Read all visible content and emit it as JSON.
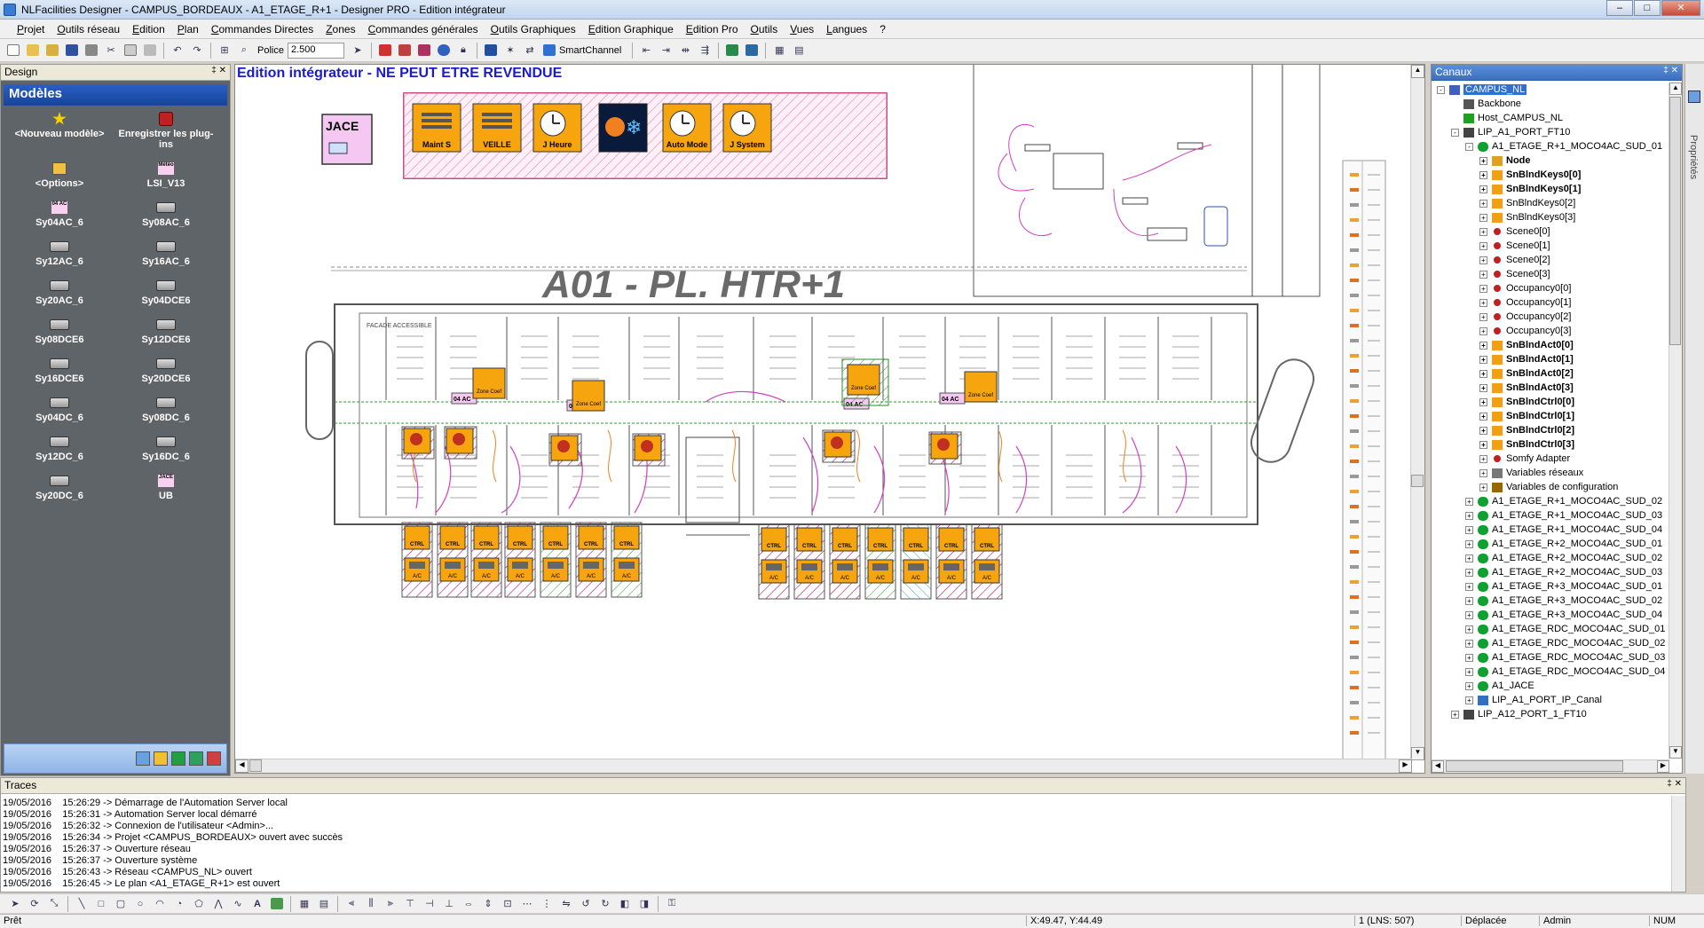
{
  "window": {
    "title": "NLFacilities Designer - CAMPUS_BORDEAUX - A1_ETAGE_R+1 - Designer PRO - Edition intégrateur",
    "min": "–",
    "max": "□",
    "close": "✕"
  },
  "menu": [
    "Projet",
    "Outils réseau",
    "Edition",
    "Plan",
    "Commandes Directes",
    "Zones",
    "Commandes générales",
    "Outils Graphiques",
    "Edition Graphique",
    "Edition Pro",
    "Outils",
    "Vues",
    "Langues",
    "?"
  ],
  "toolbar": {
    "police_label": "Police",
    "zoom": "2.500",
    "smartchannel_label": "SmartChannel"
  },
  "design_panel": {
    "header": "Design",
    "pin": "‡ ✕",
    "models_title": "Modèles",
    "models": [
      {
        "label": "<Nouveau modèle>",
        "icon": "star-wand-icon"
      },
      {
        "label": "Enregistrer les plug-ins",
        "icon": "plugin-dice-icon"
      },
      {
        "label": "<Options>",
        "icon": "options-icon"
      },
      {
        "label": "LSI_V13",
        "icon": "meteo-icon",
        "tag": "Météo"
      },
      {
        "label": "Sy04AC_6",
        "icon": "module-icon",
        "tag": "04 AC"
      },
      {
        "label": "Sy08AC_6",
        "icon": "network-icon"
      },
      {
        "label": "Sy12AC_6",
        "icon": "network-icon"
      },
      {
        "label": "Sy16AC_6",
        "icon": "network-icon"
      },
      {
        "label": "Sy20AC_6",
        "icon": "network-icon"
      },
      {
        "label": "Sy04DCE6",
        "icon": "network-icon"
      },
      {
        "label": "Sy08DCE6",
        "icon": "network-icon"
      },
      {
        "label": "Sy12DCE6",
        "icon": "network-icon"
      },
      {
        "label": "Sy16DCE6",
        "icon": "network-icon"
      },
      {
        "label": "Sy20DCE6",
        "icon": "network-icon"
      },
      {
        "label": "Sy04DC_6",
        "icon": "network-icon"
      },
      {
        "label": "Sy08DC_6",
        "icon": "network-icon"
      },
      {
        "label": "Sy12DC_6",
        "icon": "network-icon"
      },
      {
        "label": "Sy16DC_6",
        "icon": "network-icon"
      },
      {
        "label": "Sy20DC_6",
        "icon": "network-icon"
      },
      {
        "label": "UB",
        "icon": "jace-icon",
        "tag": "JACE"
      }
    ]
  },
  "canvas": {
    "title": "Edition intégrateur - NE PEUT ETRE REVENDUE",
    "plan_title": "A01 - PL. HTR+1",
    "jace_label": "JACE",
    "command_buttons": [
      "Maint S",
      "VEILLE",
      "J Heure",
      "",
      "Auto Mode",
      "J System"
    ],
    "command_icons": [
      "maintenance-icon",
      "veille-icon",
      "clock-icon",
      "weather-icon",
      "auto-mode-icon",
      "system-icon"
    ],
    "zone_labels": [
      "04 AC",
      "04 AC",
      "04 AC",
      "04 AC"
    ],
    "zone_coef_labels": [
      "Zone Coef",
      "Zone Coef",
      "Zone Coef",
      "Zone Coef"
    ],
    "ctrl_label": "CTRL",
    "ac_label": "A/C",
    "facade_label": "FACADE ACCESSIBLE",
    "colors": {
      "orange": "#f7a50e",
      "pink": "#d040c0",
      "green": "#2c9a2c",
      "hatch": "#b01060"
    }
  },
  "canaux_panel": {
    "header": "Canaux",
    "pin": "‡ ✕",
    "tree": [
      {
        "label": "CAMPUS_NL",
        "level": 0,
        "exp": "-",
        "icon": "project-icon",
        "selected": true
      },
      {
        "label": "Backbone",
        "level": 1,
        "exp": "",
        "icon": "backbone-icon"
      },
      {
        "label": "Host_CAMPUS_NL",
        "level": 1,
        "exp": "",
        "icon": "host-icon"
      },
      {
        "label": "LIP_A1_PORT_FT10",
        "level": 1,
        "exp": "-",
        "icon": "port-icon"
      },
      {
        "label": "A1_ETAGE_R+1_MOCO4AC_SUD_01",
        "level": 2,
        "exp": "-",
        "icon": "device-icon"
      },
      {
        "label": "Node",
        "level": 3,
        "exp": "+",
        "icon": "node-icon",
        "bold": true
      },
      {
        "label": "SnBlndKeys0[0]",
        "level": 3,
        "exp": "+",
        "icon": "block-icon",
        "bold": true
      },
      {
        "label": "SnBlndKeys0[1]",
        "level": 3,
        "exp": "+",
        "icon": "block-icon",
        "bold": true
      },
      {
        "label": "SnBlndKeys0[2]",
        "level": 3,
        "exp": "+",
        "icon": "block-icon"
      },
      {
        "label": "SnBlndKeys0[3]",
        "level": 3,
        "exp": "+",
        "icon": "block-icon"
      },
      {
        "label": "Scene0[0]",
        "level": 3,
        "exp": "+",
        "icon": "dot-icon"
      },
      {
        "label": "Scene0[1]",
        "level": 3,
        "exp": "+",
        "icon": "dot-icon"
      },
      {
        "label": "Scene0[2]",
        "level": 3,
        "exp": "+",
        "icon": "dot-icon"
      },
      {
        "label": "Scene0[3]",
        "level": 3,
        "exp": "+",
        "icon": "dot-icon"
      },
      {
        "label": "Occupancy0[0]",
        "level": 3,
        "exp": "+",
        "icon": "dot-icon"
      },
      {
        "label": "Occupancy0[1]",
        "level": 3,
        "exp": "+",
        "icon": "dot-icon"
      },
      {
        "label": "Occupancy0[2]",
        "level": 3,
        "exp": "+",
        "icon": "dot-icon"
      },
      {
        "label": "Occupancy0[3]",
        "level": 3,
        "exp": "+",
        "icon": "dot-icon"
      },
      {
        "label": "SnBlndAct0[0]",
        "level": 3,
        "exp": "+",
        "icon": "block-icon",
        "bold": true
      },
      {
        "label": "SnBlndAct0[1]",
        "level": 3,
        "exp": "+",
        "icon": "block-icon",
        "bold": true
      },
      {
        "label": "SnBlndAct0[2]",
        "level": 3,
        "exp": "+",
        "icon": "block-icon",
        "bold": true
      },
      {
        "label": "SnBlndAct0[3]",
        "level": 3,
        "exp": "+",
        "icon": "block-icon",
        "bold": true
      },
      {
        "label": "SnBlndCtrl0[0]",
        "level": 3,
        "exp": "+",
        "icon": "block-icon",
        "bold": true
      },
      {
        "label": "SnBlndCtrl0[1]",
        "level": 3,
        "exp": "+",
        "icon": "block-icon",
        "bold": true
      },
      {
        "label": "SnBlndCtrl0[2]",
        "level": 3,
        "exp": "+",
        "icon": "block-icon",
        "bold": true
      },
      {
        "label": "SnBlndCtrl0[3]",
        "level": 3,
        "exp": "+",
        "icon": "block-icon",
        "bold": true
      },
      {
        "label": "Somfy Adapter",
        "level": 3,
        "exp": "+",
        "icon": "dot-icon"
      },
      {
        "label": "Variables réseaux",
        "level": 3,
        "exp": "+",
        "icon": "variables-icon"
      },
      {
        "label": "Variables de configuration",
        "level": 3,
        "exp": "+",
        "icon": "config-icon"
      },
      {
        "label": "A1_ETAGE_R+1_MOCO4AC_SUD_02",
        "level": 2,
        "exp": "+",
        "icon": "device-icon"
      },
      {
        "label": "A1_ETAGE_R+1_MOCO4AC_SUD_03",
        "level": 2,
        "exp": "+",
        "icon": "device-icon"
      },
      {
        "label": "A1_ETAGE_R+1_MOCO4AC_SUD_04",
        "level": 2,
        "exp": "+",
        "icon": "device-icon"
      },
      {
        "label": "A1_ETAGE_R+2_MOCO4AC_SUD_01",
        "level": 2,
        "exp": "+",
        "icon": "device-icon"
      },
      {
        "label": "A1_ETAGE_R+2_MOCO4AC_SUD_02",
        "level": 2,
        "exp": "+",
        "icon": "device-icon"
      },
      {
        "label": "A1_ETAGE_R+2_MOCO4AC_SUD_03",
        "level": 2,
        "exp": "+",
        "icon": "device-icon"
      },
      {
        "label": "A1_ETAGE_R+3_MOCO4AC_SUD_01",
        "level": 2,
        "exp": "+",
        "icon": "device-icon"
      },
      {
        "label": "A1_ETAGE_R+3_MOCO4AC_SUD_02",
        "level": 2,
        "exp": "+",
        "icon": "device-icon"
      },
      {
        "label": "A1_ETAGE_R+3_MOCO4AC_SUD_04",
        "level": 2,
        "exp": "+",
        "icon": "device-icon"
      },
      {
        "label": "A1_ETAGE_RDC_MOCO4AC_SUD_01",
        "level": 2,
        "exp": "+",
        "icon": "device-icon"
      },
      {
        "label": "A1_ETAGE_RDC_MOCO4AC_SUD_02",
        "level": 2,
        "exp": "+",
        "icon": "device-icon"
      },
      {
        "label": "A1_ETAGE_RDC_MOCO4AC_SUD_03",
        "level": 2,
        "exp": "+",
        "icon": "device-icon"
      },
      {
        "label": "A1_ETAGE_RDC_MOCO4AC_SUD_04",
        "level": 2,
        "exp": "+",
        "icon": "device-icon"
      },
      {
        "label": "A1_JACE",
        "level": 2,
        "exp": "+",
        "icon": "device-icon"
      },
      {
        "label": "LIP_A1_PORT_IP_Canal",
        "level": 2,
        "exp": "+",
        "icon": "ip-icon"
      },
      {
        "label": "LIP_A12_PORT_1_FT10",
        "level": 1,
        "exp": "+",
        "icon": "port-icon"
      }
    ]
  },
  "props_strip": {
    "label": "Propriétés"
  },
  "traces": {
    "header": "Traces",
    "pin": "‡ ✕",
    "lines": [
      "19/05/2016    15:26:29 -> Démarrage de l'Automation Server local",
      "19/05/2016    15:26:31 -> Automation Server local démarré",
      "19/05/2016    15:26:32 -> Connexion de l'utilisateur <Admin>...",
      "19/05/2016    15:26:34 -> Projet <CAMPUS_BORDEAUX> ouvert avec succès",
      "19/05/2016    15:26:37 -> Ouverture réseau",
      "19/05/2016    15:26:37 -> Ouverture système",
      "19/05/2016    15:26:43 -> Réseau <CAMPUS_NL> ouvert",
      "19/05/2016    15:26:45 -> Le plan <A1_ETAGE_R+1> est ouvert"
    ]
  },
  "status": {
    "ready": "Prêt",
    "coords": "X:49.47, Y:44.49",
    "lns": "1 (LNS: 507)",
    "mode": "Déplacée",
    "user": "Admin",
    "num": "NUM"
  }
}
